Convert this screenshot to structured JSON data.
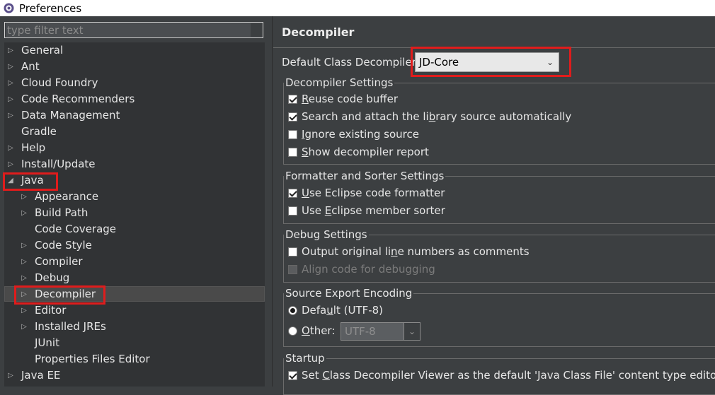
{
  "window": {
    "title": "Preferences",
    "icon": "eclipse-gear-icon"
  },
  "sidebar": {
    "filter_placeholder": "type filter text",
    "items": [
      {
        "label": "General",
        "expander": "collapsed"
      },
      {
        "label": "Ant",
        "expander": "collapsed"
      },
      {
        "label": "Cloud Foundry",
        "expander": "collapsed"
      },
      {
        "label": "Code Recommenders",
        "expander": "collapsed"
      },
      {
        "label": "Data Management",
        "expander": "collapsed"
      },
      {
        "label": "Gradle",
        "expander": "none"
      },
      {
        "label": "Help",
        "expander": "collapsed"
      },
      {
        "label": "Install/Update",
        "expander": "collapsed"
      },
      {
        "label": "Java",
        "expander": "expanded"
      },
      {
        "label": "Appearance",
        "expander": "collapsed"
      },
      {
        "label": "Build Path",
        "expander": "collapsed"
      },
      {
        "label": "Code Coverage",
        "expander": "none"
      },
      {
        "label": "Code Style",
        "expander": "collapsed"
      },
      {
        "label": "Compiler",
        "expander": "collapsed"
      },
      {
        "label": "Debug",
        "expander": "collapsed"
      },
      {
        "label": "Decompiler",
        "expander": "collapsed",
        "selected": true
      },
      {
        "label": "Editor",
        "expander": "collapsed"
      },
      {
        "label": "Installed JREs",
        "expander": "collapsed"
      },
      {
        "label": "JUnit",
        "expander": "none"
      },
      {
        "label": "Properties Files Editor",
        "expander": "none"
      },
      {
        "label": "Java EE",
        "expander": "collapsed"
      }
    ]
  },
  "page": {
    "title": "Decompiler",
    "default_decompiler": {
      "label": "Default Class Decompiler",
      "value": "JD-Core"
    },
    "groups": {
      "decompiler_settings": {
        "legend": "Decompiler Settings",
        "options": [
          {
            "pre": "",
            "mnemonic": "R",
            "post": "euse code buffer",
            "checked": true
          },
          {
            "pre": "Search and attach the li",
            "mnemonic": "b",
            "post": "rary source automatically",
            "checked": true
          },
          {
            "pre": "",
            "mnemonic": "I",
            "post": "gnore existing source",
            "checked": false
          },
          {
            "pre": "",
            "mnemonic": "S",
            "post": "how decompiler report",
            "checked": false
          }
        ]
      },
      "formatter": {
        "legend": "Formatter and Sorter Settings",
        "options": [
          {
            "pre": "",
            "mnemonic": "U",
            "post": "se Eclipse code formatter",
            "checked": true
          },
          {
            "pre": "Use ",
            "mnemonic": "E",
            "post": "clipse member sorter",
            "checked": false
          }
        ]
      },
      "debug": {
        "legend": "Debug Settings",
        "options": [
          {
            "pre": "Output original li",
            "mnemonic": "n",
            "post": "e numbers as comments",
            "checked": false
          },
          {
            "pre": "Align code for debugging",
            "mnemonic": "",
            "post": "",
            "checked": false,
            "disabled": true
          }
        ]
      },
      "encoding": {
        "legend": "Source Export Encoding",
        "default_pre": "Defa",
        "default_mnemonic": "u",
        "default_post": "lt (UTF-8)",
        "other_pre": "",
        "other_mnemonic": "O",
        "other_post": "ther:",
        "other_value": "UTF-8",
        "selected": "default"
      },
      "startup": {
        "legend": "Startup",
        "option": {
          "pre": "Set ",
          "mnemonic": "C",
          "post": "lass Decompiler Viewer as the default 'Java Class File' content type editor",
          "checked": true
        }
      }
    }
  },
  "colors": {
    "highlight": "#e01c1c",
    "panel": "#3c3f41",
    "tree": "#313335"
  }
}
